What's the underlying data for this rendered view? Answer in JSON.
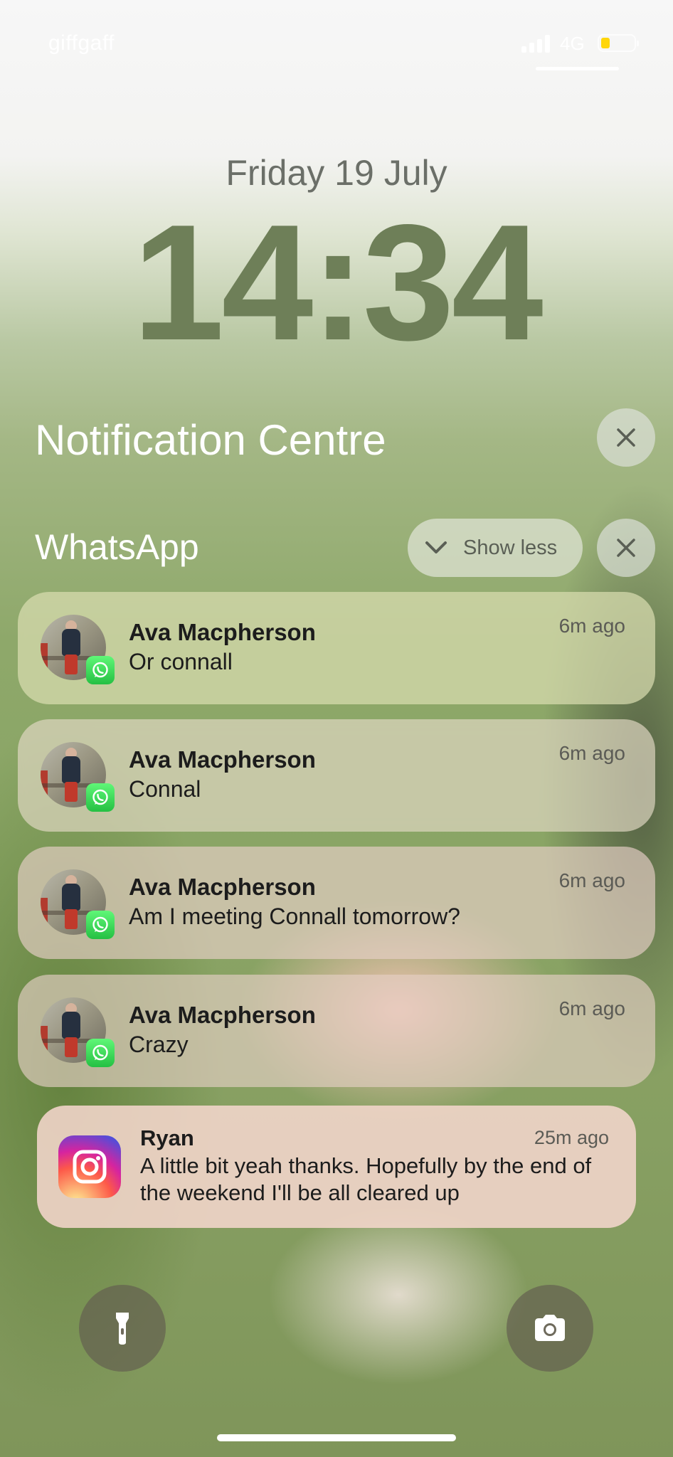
{
  "status_bar": {
    "carrier": "giffgaff",
    "network": "4G",
    "battery_color": "#ffd60a",
    "signal_icon": "signal-bars-icon",
    "battery_icon": "battery-low-icon"
  },
  "lock_screen": {
    "date": "Friday 19 July",
    "time": "14:34"
  },
  "notification_centre": {
    "title": "Notification Centre",
    "clear_icon": "close-icon"
  },
  "whatsapp_group": {
    "title": "WhatsApp",
    "show_less_label": "Show less",
    "chevron_icon": "chevron-down-icon",
    "clear_icon": "close-icon",
    "notifications": [
      {
        "sender": "Ava Macpherson",
        "message": "Or connall",
        "time_ago": "6m ago"
      },
      {
        "sender": "Ava Macpherson",
        "message": "Connal",
        "time_ago": "6m ago"
      },
      {
        "sender": "Ava Macpherson",
        "message": "Am I meeting Connall tomorrow?",
        "time_ago": "6m ago"
      },
      {
        "sender": "Ava Macpherson",
        "message": "Crazy",
        "time_ago": "6m ago"
      }
    ]
  },
  "instagram_notification": {
    "app_icon": "instagram-icon",
    "sender": "Ryan",
    "message": "A little bit yeah thanks. Hopefully by the end of the weekend I'll be all cleared up",
    "time_ago": "25m ago"
  },
  "bottom_controls": {
    "flashlight_icon": "flashlight-icon",
    "camera_icon": "camera-icon"
  }
}
